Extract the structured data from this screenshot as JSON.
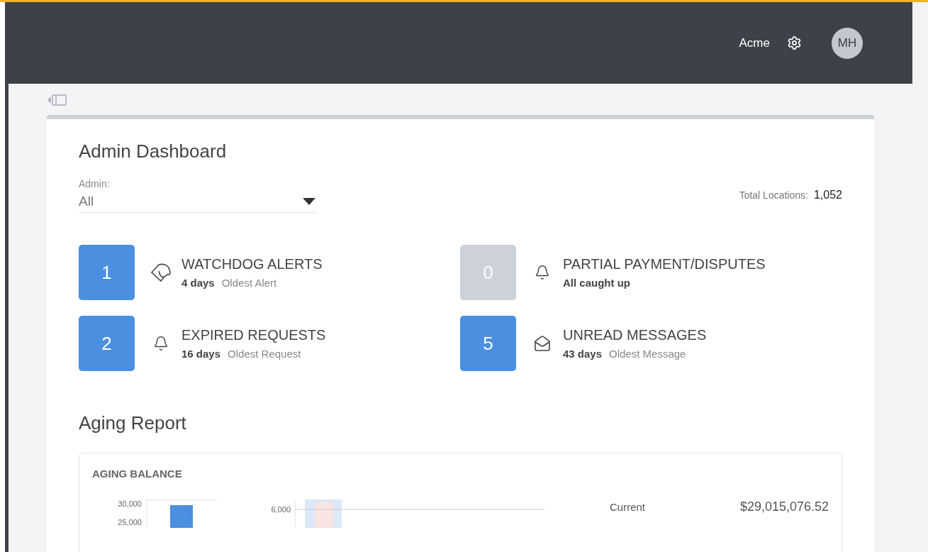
{
  "header": {
    "company": "Acme",
    "avatar": "MH"
  },
  "dashboard": {
    "title": "Admin Dashboard",
    "filter": {
      "label": "Admin:",
      "value": "All"
    },
    "total_label": "Total Locations:",
    "total_value": "1,052"
  },
  "tiles": [
    {
      "count": "1",
      "active": true,
      "kind": "dog",
      "title": "WATCHDOG ALERTS",
      "age": "4 days",
      "age_label": "Oldest Alert"
    },
    {
      "count": "0",
      "active": false,
      "kind": "bell",
      "title": "PARTIAL PAYMENT/DISPUTES",
      "age": "All caught up"
    },
    {
      "count": "2",
      "active": true,
      "kind": "bell",
      "title": "EXPIRED REQUESTS",
      "age": "16 days",
      "age_label": "Oldest Request"
    },
    {
      "count": "5",
      "active": true,
      "kind": "mail",
      "title": "UNREAD MESSAGES",
      "age": "43 days",
      "age_label": "Oldest Message"
    }
  ],
  "aging": {
    "title": "Aging Report",
    "card_title": "AGING BALANCE",
    "chart_1_ticks": [
      "30,000",
      "25,000"
    ],
    "chart_2_ticks": [
      "6,000"
    ],
    "rows": [
      {
        "label": "Current",
        "value": "$29,015,076.52"
      }
    ]
  }
}
